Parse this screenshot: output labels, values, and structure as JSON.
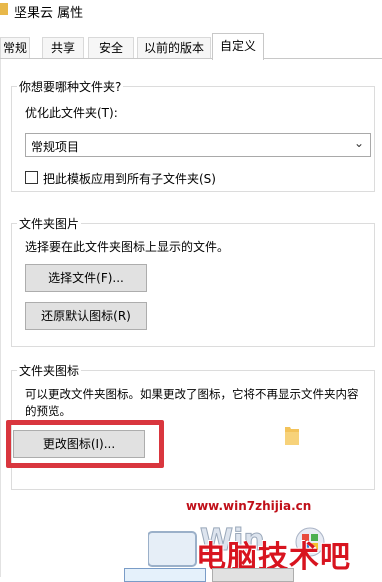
{
  "window": {
    "title": "坚果云 属性"
  },
  "tabs": [
    {
      "label": "常规"
    },
    {
      "label": "共享"
    },
    {
      "label": "安全"
    },
    {
      "label": "以前的版本"
    },
    {
      "label": "自定义"
    }
  ],
  "folder_type": {
    "title": "你想要哪种文件夹?",
    "optimize_label": "优化此文件夹(T):",
    "selected_option": "常规项目",
    "apply_checkbox_label": "把此模板应用到所有子文件夹(S)",
    "apply_checked": false
  },
  "folder_picture": {
    "title": "文件夹图片",
    "description": "选择要在此文件夹图标上显示的文件。",
    "choose_file_label": "选择文件(F)...",
    "restore_default_label": "还原默认图标(R)"
  },
  "folder_icon": {
    "title": "文件夹图标",
    "description_line1": "可以更改文件夹图标。如果更改了图标，它将不再显示文件夹内容",
    "description_line2": "的预览。",
    "change_icon_label": "更改图标(I)..."
  },
  "watermark": {
    "url": "www.win7zhijia.cn",
    "text": "电脑技术吧"
  },
  "colors": {
    "highlight": "#d9363e",
    "folder": "#f3c35a",
    "watermark": "#d8141f"
  }
}
